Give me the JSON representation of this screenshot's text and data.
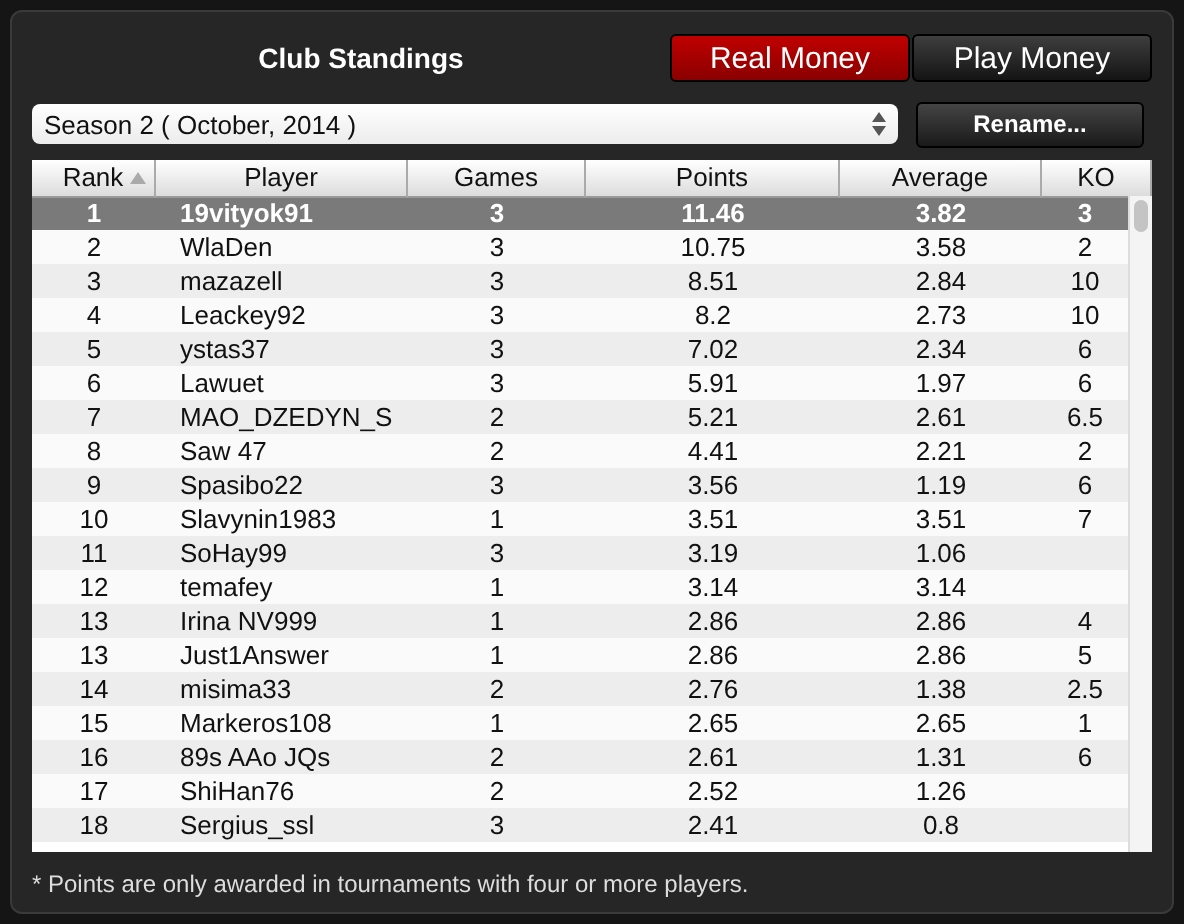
{
  "title": "Club Standings",
  "money_toggle": [
    {
      "label": "Real Money",
      "selected": true
    },
    {
      "label": "Play Money",
      "selected": false
    }
  ],
  "season_select": {
    "value": "Season 2 ( October, 2014 )"
  },
  "rename_button": "Rename...",
  "table": {
    "columns": [
      {
        "label": "Rank",
        "sorted": true
      },
      {
        "label": "Player",
        "sorted": false
      },
      {
        "label": "Games",
        "sorted": false
      },
      {
        "label": "Points",
        "sorted": false
      },
      {
        "label": "Average",
        "sorted": false
      },
      {
        "label": "KO",
        "sorted": false
      }
    ],
    "rows": [
      {
        "rank": "1",
        "player": "19vityok91",
        "games": "3",
        "points": "11.46",
        "average": "3.82",
        "ko": "3",
        "selected": true
      },
      {
        "rank": "2",
        "player": "WlaDen",
        "games": "3",
        "points": "10.75",
        "average": "3.58",
        "ko": "2",
        "selected": false
      },
      {
        "rank": "3",
        "player": "mazazell",
        "games": "3",
        "points": "8.51",
        "average": "2.84",
        "ko": "10",
        "selected": false
      },
      {
        "rank": "4",
        "player": "Leackey92",
        "games": "3",
        "points": "8.2",
        "average": "2.73",
        "ko": "10",
        "selected": false
      },
      {
        "rank": "5",
        "player": "ystas37",
        "games": "3",
        "points": "7.02",
        "average": "2.34",
        "ko": "6",
        "selected": false
      },
      {
        "rank": "6",
        "player": "Lawuet",
        "games": "3",
        "points": "5.91",
        "average": "1.97",
        "ko": "6",
        "selected": false
      },
      {
        "rank": "7",
        "player": "MAO_DZEDYN_S",
        "games": "2",
        "points": "5.21",
        "average": "2.61",
        "ko": "6.5",
        "selected": false
      },
      {
        "rank": "8",
        "player": "Saw 47",
        "games": "2",
        "points": "4.41",
        "average": "2.21",
        "ko": "2",
        "selected": false
      },
      {
        "rank": "9",
        "player": "Spasibo22",
        "games": "3",
        "points": "3.56",
        "average": "1.19",
        "ko": "6",
        "selected": false
      },
      {
        "rank": "10",
        "player": "Slavynin1983",
        "games": "1",
        "points": "3.51",
        "average": "3.51",
        "ko": "7",
        "selected": false
      },
      {
        "rank": "11",
        "player": "SoHay99",
        "games": "3",
        "points": "3.19",
        "average": "1.06",
        "selected": false
      },
      {
        "rank": "12",
        "player": "temafey",
        "games": "1",
        "points": "3.14",
        "average": "3.14",
        "selected": false
      },
      {
        "rank": "13",
        "player": "Irina NV999",
        "games": "1",
        "points": "2.86",
        "average": "2.86",
        "ko": "4",
        "selected": false
      },
      {
        "rank": "13",
        "player": "Just1Answer",
        "games": "1",
        "points": "2.86",
        "average": "2.86",
        "ko": "5",
        "selected": false
      },
      {
        "rank": "14",
        "player": "misima33",
        "games": "2",
        "points": "2.76",
        "average": "1.38",
        "ko": "2.5",
        "selected": false
      },
      {
        "rank": "15",
        "player": "Markeros108",
        "games": "1",
        "points": "2.65",
        "average": "2.65",
        "ko": "1",
        "selected": false
      },
      {
        "rank": "16",
        "player": "89s AAo JQs",
        "games": "2",
        "points": "2.61",
        "average": "1.31",
        "ko": "6",
        "selected": false
      },
      {
        "rank": "17",
        "player": "ShiHan76",
        "games": "2",
        "points": "2.52",
        "average": "1.26",
        "selected": false
      },
      {
        "rank": "18",
        "player": "Sergius_ssl",
        "games": "3",
        "points": "2.41",
        "average": "0.8",
        "selected": false
      }
    ]
  },
  "footnote": "* Points are only awarded in tournaments with four or more players."
}
